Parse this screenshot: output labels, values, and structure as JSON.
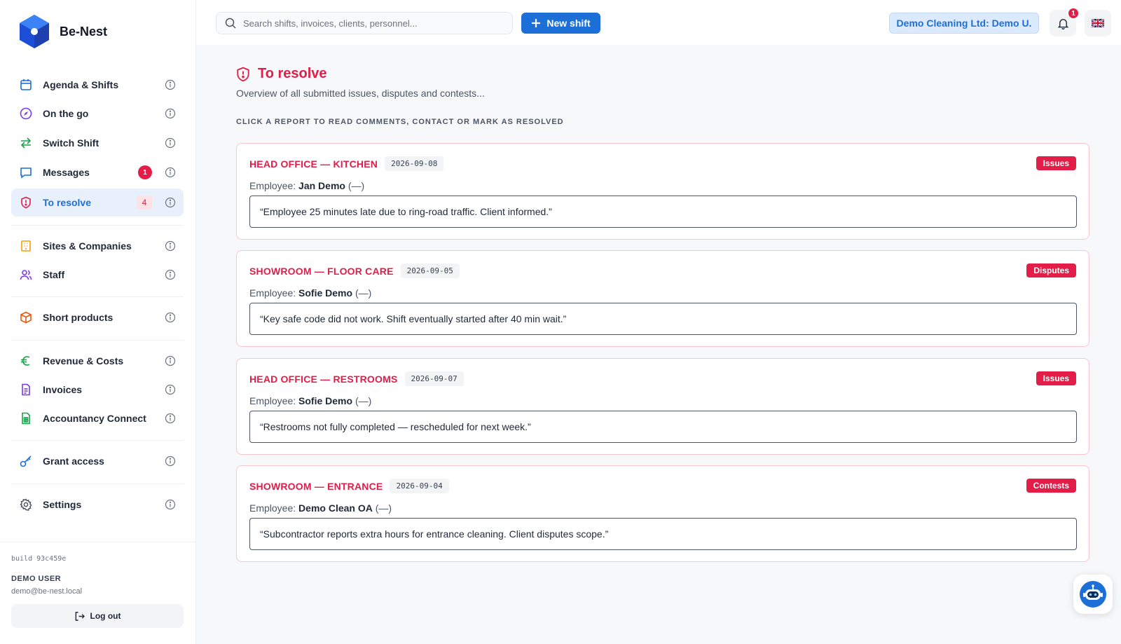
{
  "brand": {
    "name": "Be-Nest"
  },
  "sidebar": {
    "items": [
      {
        "label": "Agenda & Shifts",
        "icon": "calendar-icon"
      },
      {
        "label": "On the go",
        "icon": "compass-icon"
      },
      {
        "label": "Switch Shift",
        "icon": "switch-arrows-icon"
      },
      {
        "label": "Messages",
        "icon": "message-icon",
        "badge": "1"
      },
      {
        "label": "To resolve",
        "icon": "shield-alert-icon",
        "badge": "4",
        "active": true
      },
      {
        "label": "Sites & Companies",
        "icon": "building-icon"
      },
      {
        "label": "Staff",
        "icon": "users-icon"
      },
      {
        "label": "Short products",
        "icon": "box-icon"
      },
      {
        "label": "Revenue & Costs",
        "icon": "euro-icon"
      },
      {
        "label": "Invoices",
        "icon": "document-icon"
      },
      {
        "label": "Accountancy Connect",
        "icon": "spreadsheet-icon"
      },
      {
        "label": "Grant access",
        "icon": "key-icon"
      },
      {
        "label": "Settings",
        "icon": "gear-icon"
      }
    ],
    "build": "build 93c459e",
    "user_name": "DEMO USER",
    "user_email": "demo@be-nest.local",
    "logout_label": "Log out"
  },
  "header": {
    "search_placeholder": "Search shifts, invoices, clients, personnel...",
    "new_shift_label": "New shift",
    "company_label": "Demo Cleaning Ltd: Demo U.",
    "notifications_count": "1",
    "language": "en-gb-flag-icon"
  },
  "main": {
    "title": "To resolve",
    "subtitle": "Overview of all submitted issues, disputes and contests...",
    "hint": "CLICK A REPORT TO READ COMMENTS, CONTACT OR MARK AS RESOLVED",
    "employee_label": "Employee:",
    "reports": [
      {
        "title": "HEAD OFFICE — KITCHEN",
        "date": "2026-09-08",
        "tag": "Issues",
        "employee": "Jan Demo",
        "employee_suffix": "(—)",
        "comment": "“Employee 25 minutes late due to ring-road traffic. Client informed.”"
      },
      {
        "title": "SHOWROOM — FLOOR CARE",
        "date": "2026-09-05",
        "tag": "Disputes",
        "employee": "Sofie Demo",
        "employee_suffix": "(—)",
        "comment": "“Key safe code did not work. Shift eventually started after 40 min wait.”"
      },
      {
        "title": "HEAD OFFICE — RESTROOMS",
        "date": "2026-09-07",
        "tag": "Issues",
        "employee": "Sofie Demo",
        "employee_suffix": "(—)",
        "comment": "“Restrooms not fully completed — rescheduled for next week.”"
      },
      {
        "title": "SHOWROOM — ENTRANCE",
        "date": "2026-09-04",
        "tag": "Contests",
        "employee": "Demo Clean OA",
        "employee_suffix": "(—)",
        "comment": "“Subcontractor reports extra hours for entrance cleaning. Client disputes scope.”"
      }
    ]
  },
  "colors": {
    "accent": "#1d6fd8",
    "danger": "#e11d48"
  }
}
